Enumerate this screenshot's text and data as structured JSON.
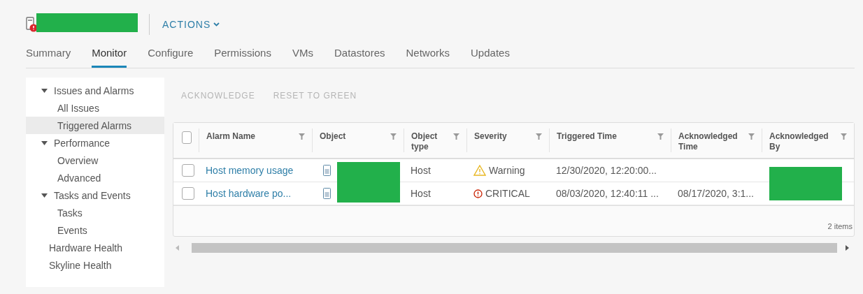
{
  "header": {
    "actions_label": "ACTIONS"
  },
  "tabs": [
    {
      "label": "Summary",
      "selected": false
    },
    {
      "label": "Monitor",
      "selected": true
    },
    {
      "label": "Configure",
      "selected": false
    },
    {
      "label": "Permissions",
      "selected": false
    },
    {
      "label": "VMs",
      "selected": false
    },
    {
      "label": "Datastores",
      "selected": false
    },
    {
      "label": "Networks",
      "selected": false
    },
    {
      "label": "Updates",
      "selected": false
    }
  ],
  "sidebar": {
    "items": [
      {
        "label": "Issues and Alarms",
        "expanded": true,
        "selected": false,
        "children": [
          {
            "label": "All Issues",
            "selected": false
          },
          {
            "label": "Triggered Alarms",
            "selected": true
          }
        ]
      },
      {
        "label": "Performance",
        "expanded": true,
        "selected": false,
        "children": [
          {
            "label": "Overview",
            "selected": false
          },
          {
            "label": "Advanced",
            "selected": false
          }
        ]
      },
      {
        "label": "Tasks and Events",
        "expanded": true,
        "selected": false,
        "children": [
          {
            "label": "Tasks",
            "selected": false
          },
          {
            "label": "Events",
            "selected": false
          }
        ]
      },
      {
        "label": "Hardware Health",
        "selected": false
      },
      {
        "label": "Skyline Health",
        "selected": false
      }
    ]
  },
  "toolbar": [
    {
      "label": "ACKNOWLEDGE",
      "disabled": true
    },
    {
      "label": "RESET TO GREEN",
      "disabled": true
    }
  ],
  "table": {
    "select_all_checked": false,
    "columns": [
      "Alarm Name",
      "Object",
      "Object type",
      "Severity",
      "Triggered Time",
      "Acknowledged Time",
      "Acknowledged By"
    ],
    "rows": [
      {
        "checked": false,
        "alarm_name": "Host memory usage",
        "object_type": "Host",
        "severity": {
          "kind": "warning",
          "label": "Warning"
        },
        "triggered_time": "12/30/2020, 12:20:00..."
      },
      {
        "checked": false,
        "alarm_name": "Host hardware po...",
        "object_type": "Host",
        "severity": {
          "kind": "critical",
          "label": "CRITICAL"
        },
        "triggered_time": "08/03/2020, 12:40:11 ...",
        "acknowledged_time": "08/17/2020, 3:1..."
      }
    ],
    "footer": "2 items"
  }
}
